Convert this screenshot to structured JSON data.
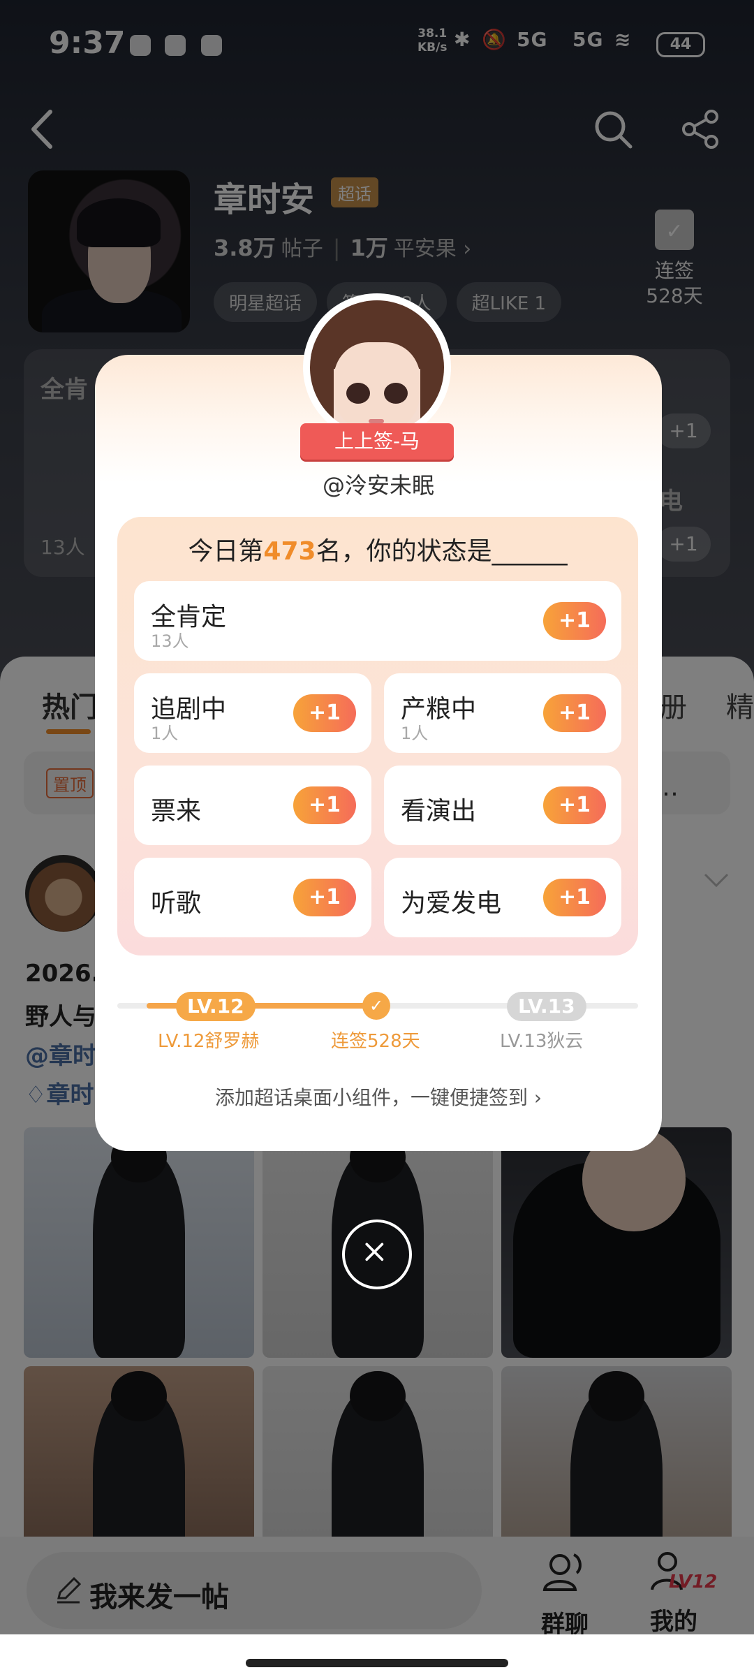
{
  "status_bar": {
    "time": "9:37",
    "net_speed_value": "38.1",
    "net_speed_unit": "KB/s",
    "signal_1": "5G",
    "signal_2": "5G",
    "battery": "44"
  },
  "topic": {
    "title": "章时安",
    "badge": "超话",
    "posts_count": "3.8万",
    "posts_label": "帖子",
    "fruit_count": "1万",
    "fruit_label": "平安果 ›",
    "chips": [
      "明星超话",
      "签到472人",
      "超LIKE 1"
    ],
    "checkin_label": "连签",
    "checkin_days": "528天"
  },
  "background_panel": {
    "left_label": "全肯",
    "right_label": "电",
    "plus": "+1",
    "count": "13人"
  },
  "feed": {
    "tab_hot": "热门",
    "tab_album": "册",
    "tab_featured": "精",
    "pin_tag": "置顶",
    "pin_more": "号…",
    "post_line1": "2026.",
    "post_line2": "野人与",
    "post_at1": "@章时",
    "post_at2": "章时"
  },
  "bottom_bar": {
    "compose": "我来发一帖",
    "group_chat": "群聊",
    "mine": "我的",
    "mine_badge": "LV12"
  },
  "dialog": {
    "badge_title": "上上签-马",
    "username": "@泠安未眠",
    "question_prefix": "今日第",
    "rank": "473",
    "question_suffix": "名，你的状态是______",
    "options": [
      {
        "name": "全肯定",
        "count": "13人",
        "plus": "+1"
      },
      {
        "name": "追剧中",
        "count": "1人",
        "plus": "+1"
      },
      {
        "name": "产粮中",
        "count": "1人",
        "plus": "+1"
      },
      {
        "name": "票来",
        "count": "",
        "plus": "+1"
      },
      {
        "name": "看演出",
        "count": "",
        "plus": "+1"
      },
      {
        "name": "听歌",
        "count": "",
        "plus": "+1"
      },
      {
        "name": "为爱发电",
        "count": "",
        "plus": "+1"
      }
    ],
    "level_current_pill": "LV.12",
    "level_next_pill": "LV.13",
    "level_current_label": "LV.12舒罗赫",
    "streak_label": "连签528天",
    "level_next_label": "LV.13狄云",
    "widget_link": "添加超话桌面小组件，一键便捷签到 ›"
  },
  "colors": {
    "accent_orange": "#f08c2a",
    "plus_gradient_start": "#f7a339",
    "plus_gradient_end": "#f56c59",
    "ribbon_red": "#ef5a57"
  }
}
